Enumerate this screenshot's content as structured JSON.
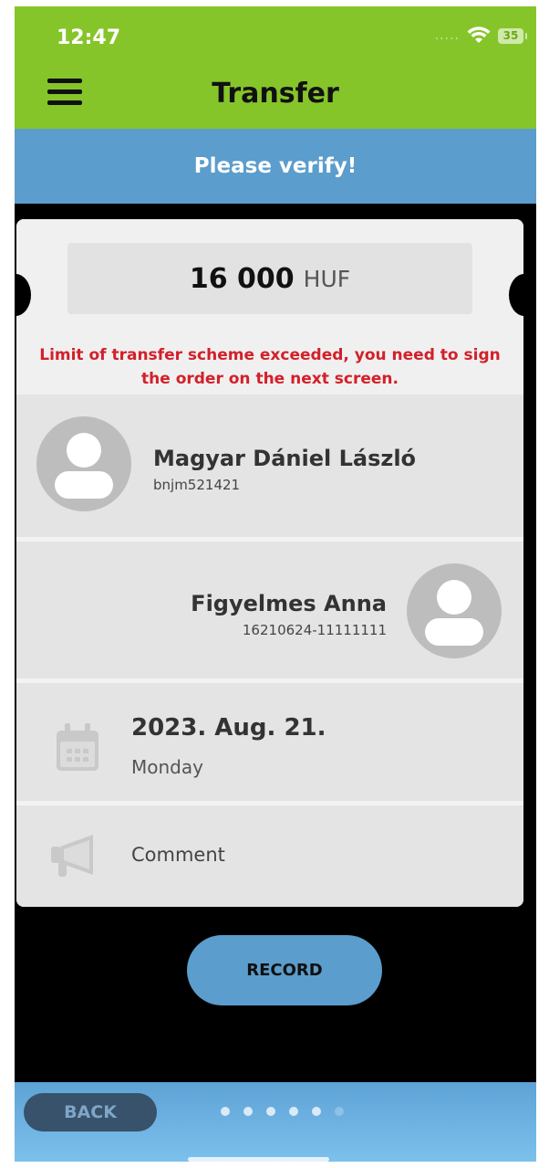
{
  "status_bar": {
    "time": "12:47",
    "signal": ".....",
    "battery": "35"
  },
  "header": {
    "title": "Transfer",
    "menu_icon": "menu-icon"
  },
  "verify_banner": {
    "text": "Please verify!"
  },
  "amount": {
    "value": "16 000",
    "currency": "HUF"
  },
  "warning": {
    "text": "Limit of transfer scheme exceeded, you need to sign the order on the next screen.",
    "color": "#d3202a"
  },
  "sender": {
    "name": "Magyar Dániel László",
    "id": "bnjm521421",
    "icon": "user-avatar-icon"
  },
  "recipient": {
    "name": "Figyelmes Anna",
    "account": "16210624-11111111",
    "icon": "user-avatar-icon"
  },
  "date": {
    "main": "2023. Aug. 21.",
    "day": "Monday",
    "icon": "calendar-icon"
  },
  "comment": {
    "label": "Comment",
    "icon": "megaphone-icon"
  },
  "actions": {
    "record_label": "RECORD",
    "back_label": "BACK"
  },
  "pagination": {
    "total": 6,
    "active_visible": 5
  },
  "colors": {
    "header_green": "#86c52a",
    "accent_blue": "#5b9dcc",
    "back_button": "#37526a"
  }
}
